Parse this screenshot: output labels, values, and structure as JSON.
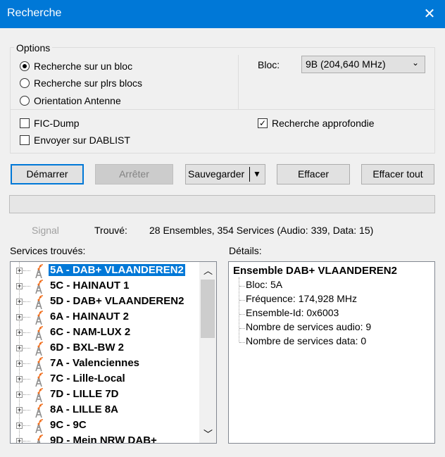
{
  "window": {
    "title": "Recherche",
    "close": "✕"
  },
  "options": {
    "legend": "Options",
    "radios": [
      {
        "label": "Recherche sur un bloc",
        "checked": true
      },
      {
        "label": "Recherche sur plrs blocs",
        "checked": false
      },
      {
        "label": "Orientation Antenne",
        "checked": false
      }
    ],
    "bloc_label": "Bloc:",
    "bloc_value": "9B (204,640 MHz)",
    "fic_dump": {
      "label": "FIC-Dump",
      "checked": false
    },
    "dablist": {
      "label": "Envoyer sur DABLIST",
      "checked": false
    },
    "deep": {
      "label": "Recherche approfondie",
      "checked": true,
      "mark": "✓"
    }
  },
  "buttons": {
    "start": "Démarrer",
    "stop": "Arrêter",
    "save": "Sauvegarder",
    "clear": "Effacer",
    "clear_all": "Effacer tout"
  },
  "status": {
    "signal": "Signal",
    "found_label": "Trouvé:",
    "found_value": "28 Ensembles, 354 Services (Audio: 339, Data: 15)"
  },
  "services": {
    "label": "Services trouvés:",
    "items": [
      "5A - DAB+ VLAANDEREN2",
      "5C - HAINAUT 1",
      "5D - DAB+ VLAANDEREN2",
      "6A - HAINAUT 2",
      "6C - NAM-LUX 2",
      "6D - BXL-BW 2",
      "7A - Valenciennes",
      "7C - Lille-Local",
      "7D - LILLE 7D",
      "8A - LILLE 8A",
      "9C - 9C",
      "9D - Mein NRW DAB+"
    ]
  },
  "details": {
    "label": "Détails:",
    "title": "Ensemble DAB+ VLAANDEREN2",
    "lines": [
      "Bloc: 5A",
      "Fréquence: 174,928 MHz",
      "Ensemble-Id: 0x6003",
      "Nombre de services audio: 9",
      "Nombre de services data: 0"
    ]
  },
  "colors": {
    "accent": "#0078d7"
  }
}
